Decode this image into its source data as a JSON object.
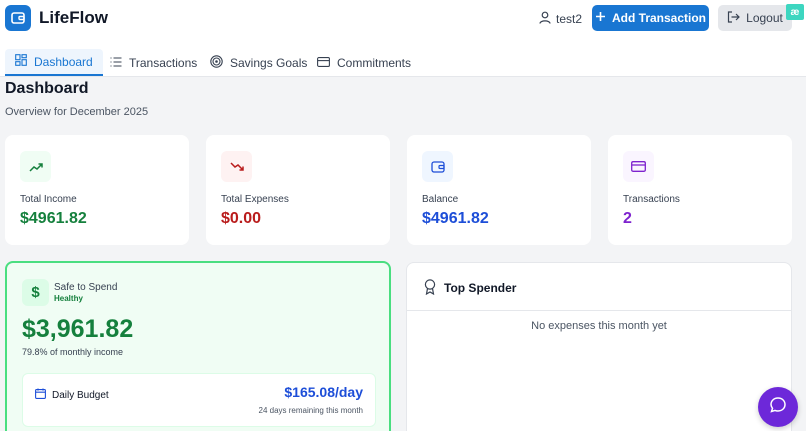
{
  "app": {
    "title": "LifeFlow"
  },
  "header": {
    "username": "test2",
    "add_transaction_label": "Add Transaction",
    "logout_label": "Logout",
    "extension_badge": "æ"
  },
  "tabs": [
    {
      "label": "Dashboard",
      "icon": "grid-icon",
      "active": true
    },
    {
      "label": "Transactions",
      "icon": "list-icon",
      "active": false
    },
    {
      "label": "Savings Goals",
      "icon": "target-icon",
      "active": false
    },
    {
      "label": "Commitments",
      "icon": "card-icon",
      "active": false
    }
  ],
  "dashboard": {
    "title": "Dashboard",
    "subtitle": "Overview for December 2025"
  },
  "stats": [
    {
      "label": "Total Income",
      "value": "$4961.82",
      "icon": "trending-up-icon",
      "color": "#15803d",
      "bg": "#f0fdf4"
    },
    {
      "label": "Total Expenses",
      "value": "$0.00",
      "icon": "trending-down-icon",
      "color": "#b91c1c",
      "bg": "#fef2f2"
    },
    {
      "label": "Balance",
      "value": "$4961.82",
      "icon": "wallet-icon",
      "color": "#1d4ed8",
      "bg": "#eff6ff"
    },
    {
      "label": "Transactions",
      "value": "2",
      "icon": "credit-card-icon",
      "color": "#7e22ce",
      "bg": "#faf5ff"
    }
  ],
  "safe_to_spend": {
    "title": "Safe to Spend",
    "status": "Healthy",
    "amount": "$3,961.82",
    "percent_note": "79.8% of monthly income",
    "daily_budget_label": "Daily Budget",
    "daily_budget_value": "$165.08/day",
    "days_remaining_note": "24 days remaining this month"
  },
  "top_spender": {
    "title": "Top Spender",
    "empty_message": "No expenses this month yet"
  },
  "colors": {
    "primary": "#1976d2",
    "chat_fab": "#6d28d9"
  }
}
